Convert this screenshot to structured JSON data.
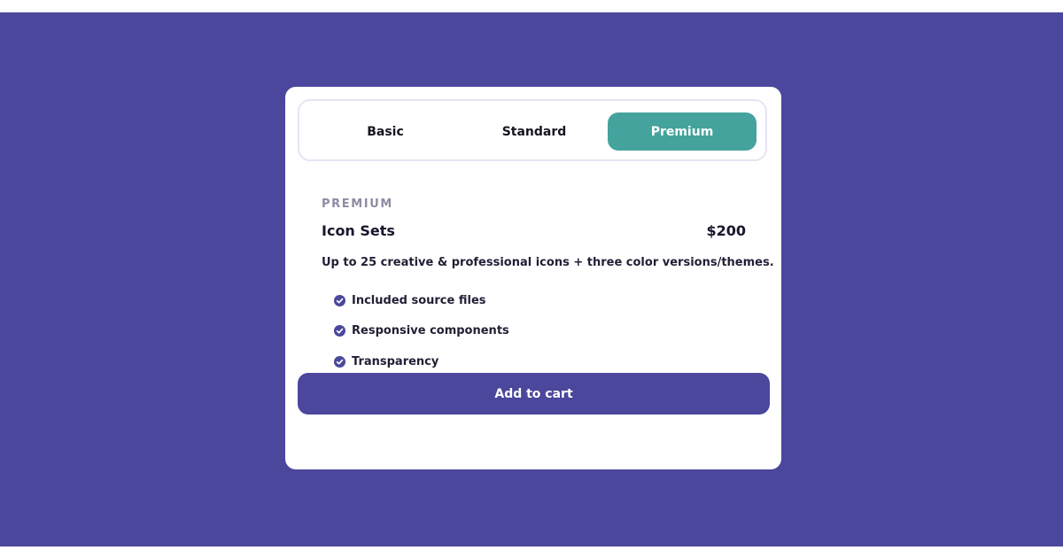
{
  "tabs": [
    {
      "label": "Basic"
    },
    {
      "label": "Standard"
    },
    {
      "label": "Premium"
    }
  ],
  "plan": {
    "tier_label": "PREMIUM",
    "name": "Icon Sets",
    "price": "$200",
    "description": "Up to 25 creative & professional icons + three color versions/themes.",
    "features": [
      {
        "label": "Included source files",
        "icon": "check-circle-icon"
      },
      {
        "label": "Responsive components",
        "icon": "check-circle-icon"
      },
      {
        "label": "Transparency",
        "icon": "check-circle-icon"
      }
    ]
  },
  "cta": {
    "label": "Add to cart"
  },
  "colors": {
    "background": "#4b479c",
    "card": "#ffffff",
    "active_tab": "#45a39d",
    "button": "#4b479c",
    "check_icon": "#4b479c",
    "muted_text": "#8f8ba3",
    "text": "#19162c"
  }
}
